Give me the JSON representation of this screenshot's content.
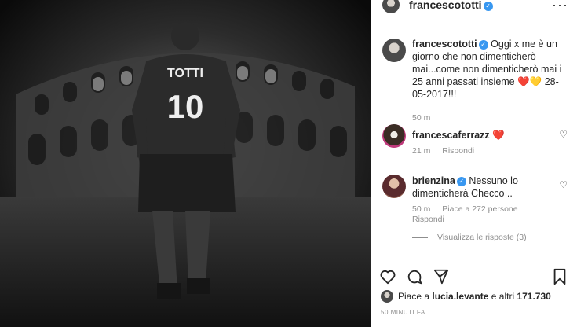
{
  "photo": {
    "jersey_name": "TOTTI",
    "jersey_number": "10"
  },
  "header": {
    "username": "francescototti",
    "more_icon": "more-horizontal-icon"
  },
  "caption": {
    "username": "francescototti",
    "text": "Oggi x me è un giorno che non dimenticherò mai...come non dimenticherò mai i 25 anni passati insieme ❤️💛 28-05-2017!!!",
    "time": "50 m"
  },
  "comments": [
    {
      "username": "francescaferrazz",
      "text": "❤️",
      "time": "21 m",
      "reply_label": "Rispondi",
      "likes_label": ""
    },
    {
      "username": "brienzina",
      "text": "Nessuno lo dimenticherà Checco ..",
      "time": "50 m",
      "likes_label": "Piace a 272 persone",
      "reply_label": "Rispondi"
    }
  ],
  "view_replies_label": "Visualizza le risposte (3)",
  "likes": {
    "prefix": "Piace a",
    "user": "lucia.levante",
    "middle": "e altri",
    "count": "171.730"
  },
  "post_time": "50 MINUTI FA",
  "colors": {
    "verified": "#3897f0",
    "muted": "#8e8e8e",
    "text": "#262626"
  }
}
